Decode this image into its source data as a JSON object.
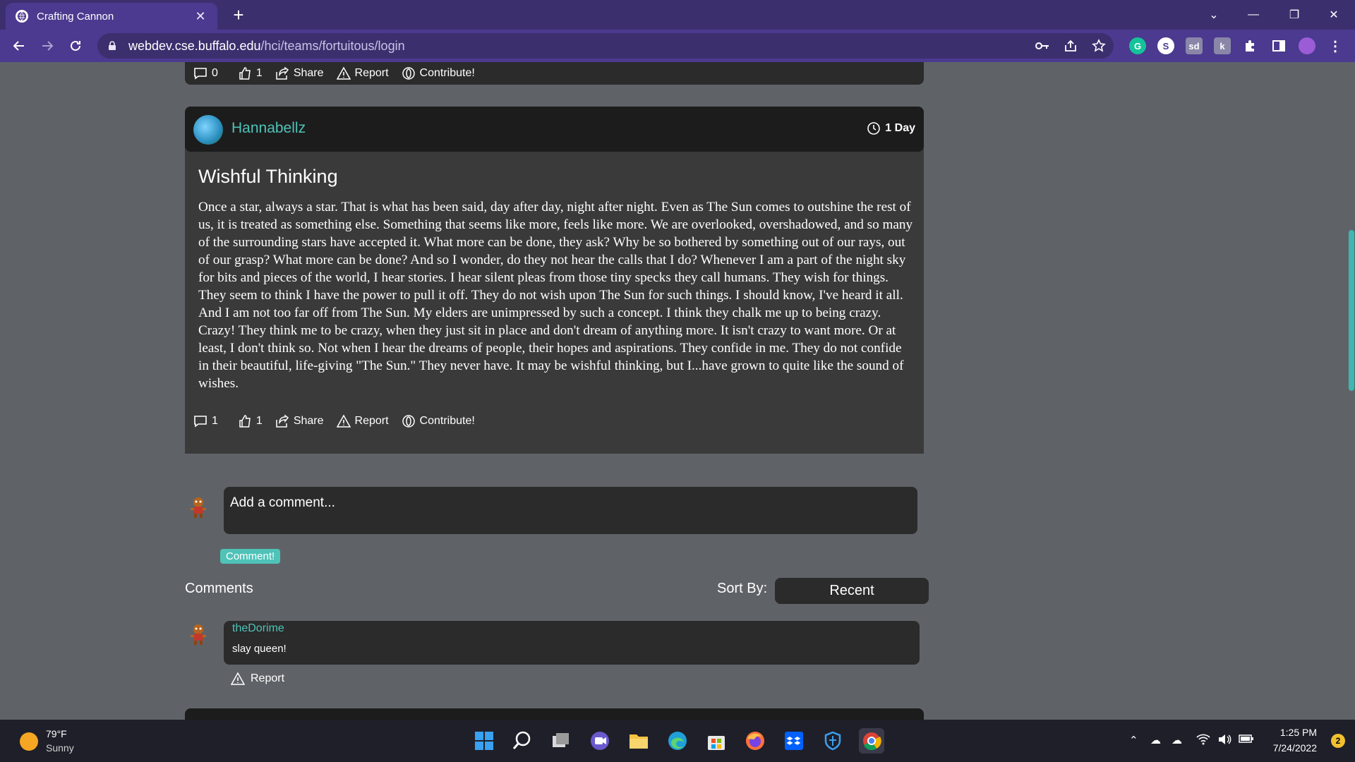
{
  "browser": {
    "tab_title": "Crafting Cannon",
    "new_tab": "+",
    "url_host": "webdev.cse.buffalo.edu",
    "url_path": "/hci/teams/fortuitous/login",
    "window_controls": {
      "minimize": "—",
      "restore": "❐",
      "close": "✕",
      "tab_search": "⌄"
    }
  },
  "prev_post": {
    "comments": "0",
    "likes": "1",
    "share": "Share",
    "report": "Report",
    "contribute": "Contribute!"
  },
  "post": {
    "author": "Hannabellz",
    "time": "1 Day",
    "title": "Wishful Thinking",
    "body": "Once a star, always a star. That is what has been said, day after day, night after night. Even as The Sun comes to outshine the rest of us, it is treated as something else. Something that seems like more, feels like more. We are overlooked, overshadowed, and so many of the surrounding stars have accepted it. What more can be done, they ask? Why be so bothered by something out of our rays, out of our grasp? What more can be done? And so I wonder, do they not hear the calls that I do? Whenever I am a part of the night sky for bits and pieces of the world, I hear stories. I hear silent pleas from those tiny specks they call humans. They wish for things. They seem to think I have the power to pull it off. They do not wish upon The Sun for such things. I should know, I've heard it all. And I am not too far off from The Sun. My elders are unimpressed by such a concept. I think they chalk me up to being crazy. Crazy! They think me to be crazy, when they just sit in place and don't dream of anything more. It isn't crazy to want more. Or at least, I don't think so. Not when I hear the dreams of people, their hopes and aspirations. They confide in me. They do not confide in their beautiful, life-giving \"The Sun.\" They never have. It may be wishful thinking, but I...have grown to quite like the sound of wishes.",
    "comments": "1",
    "likes": "1",
    "share": "Share",
    "report": "Report",
    "contribute": "Contribute!"
  },
  "comment_form": {
    "placeholder": "Add a comment...",
    "submit": "Comment!"
  },
  "comments_section": {
    "heading": "Comments",
    "sort_label": "Sort By:",
    "sort_value": "Recent",
    "items": [
      {
        "author": "theDorime",
        "text": "slay queen!",
        "report": "Report"
      }
    ]
  },
  "taskbar": {
    "temperature": "79°F",
    "condition": "Sunny",
    "time": "1:25 PM",
    "date": "7/24/2022",
    "notifications": "2"
  },
  "colors": {
    "accent": "#4fc3b8",
    "browser_frame": "#4b3a8f",
    "page_bg": "#5f6368",
    "card_bg": "#3a3a3a"
  }
}
